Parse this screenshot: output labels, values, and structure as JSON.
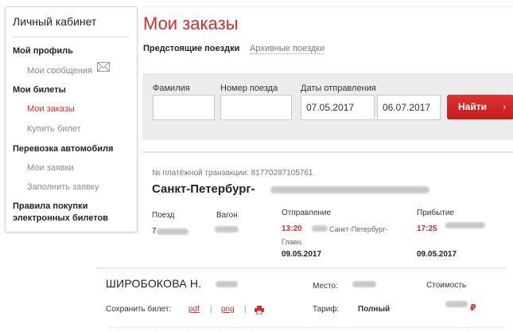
{
  "sidebar": {
    "title": "Личный кабинет",
    "items": [
      {
        "label": "Мой профиль"
      },
      {
        "label": "Мои сообщения"
      },
      {
        "label": "Мои билеты"
      },
      {
        "label": "Мои заказы"
      },
      {
        "label": "Купить билет"
      },
      {
        "label": "Перевозка автомобиля"
      },
      {
        "label": "Мои заявки"
      },
      {
        "label": "Заполнить заявку"
      },
      {
        "label_line1": "Правила покупки",
        "label_line2": "электронных билетов"
      }
    ]
  },
  "main": {
    "title": "Мои заказы",
    "tabs": [
      {
        "label": "Предстоящие поездки"
      },
      {
        "label": "Архивные поездки"
      }
    ]
  },
  "filter": {
    "surname_label": "Фамилия",
    "surname_value": "",
    "train_label": "Номер поезда",
    "train_value": "",
    "dates_label": "Даты отправления",
    "date_from": "07.05.2017",
    "date_to": "06.07.2017",
    "find_label": "Найти",
    "find_arrow": "›"
  },
  "order": {
    "transaction": "№ платёжной транзакции: 81770287105761",
    "route": "Санкт-Петербург-",
    "train_label": "Поезд",
    "train_value": "7",
    "car_label": "Вагон",
    "departure_label": "Отправление",
    "departure_time": "13:20",
    "departure_station_line1": "Санкт-Петербург-",
    "departure_station_line2": "Главн.",
    "departure_date": "09.05.2017",
    "arrival_label": "Прибытие",
    "arrival_time": "17:25",
    "arrival_date": "09.05.2017"
  },
  "passenger": {
    "name": "ШИРОБОКОВА Н.",
    "seat_label": "Место:",
    "cost_label": "Стоимость",
    "save_label": "Сохранить билет:",
    "pdf_label": "pdf",
    "png_label": "png",
    "separator": "|",
    "tariff_label": "Тариф:",
    "tariff_value": "Полный",
    "currency": "₽"
  },
  "colors": {
    "accent": "#d42d2d",
    "panel": "#ececec"
  },
  "icons": [
    "envelope-icon",
    "chevron-right-icon",
    "printer-icon"
  ]
}
